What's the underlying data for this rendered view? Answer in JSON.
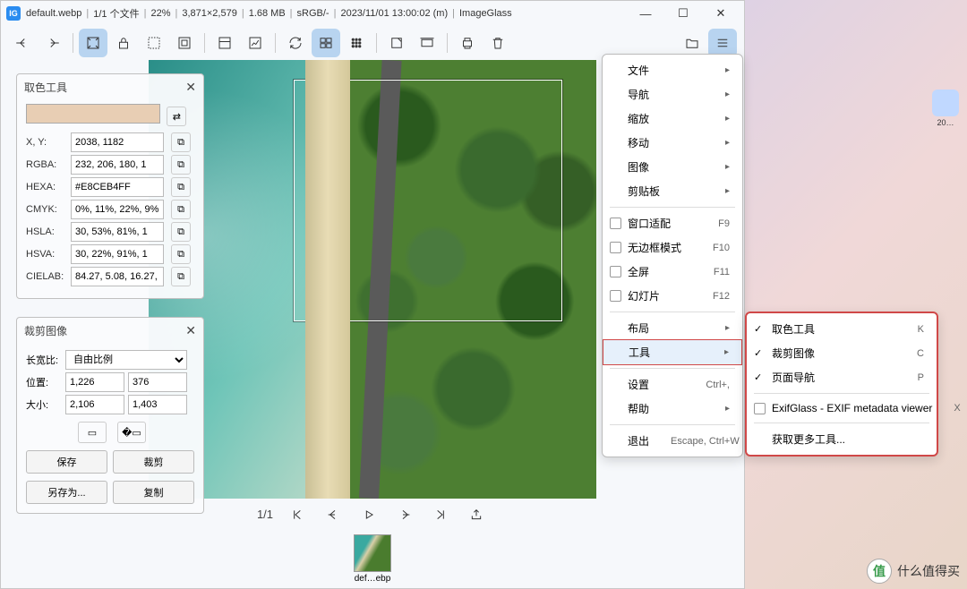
{
  "titlebar": {
    "app_icon": "IG",
    "filename": "default.webp",
    "file_count": "1/1 个文件",
    "zoom": "22%",
    "dimensions": "3,871×2,579",
    "filesize": "1.68 MB",
    "colorspace": "sRGB/-",
    "datetime": "2023/11/01 13:00:02 (m)",
    "app_name": "ImageGlass",
    "sep": "|"
  },
  "winbtns": {
    "min": "—",
    "max": "☐",
    "close": "✕"
  },
  "toolbar": {
    "names": [
      "back",
      "forward",
      "fit-window",
      "lock",
      "select",
      "crop",
      "color-picker",
      "chart",
      "refresh",
      "grid-small",
      "grid-large",
      "fullscreen",
      "slideshow",
      "print",
      "delete",
      "open",
      "menu"
    ]
  },
  "color_picker": {
    "title": "取色工具",
    "xy_label": "X, Y:",
    "xy_value": "2038, 1182",
    "rgba_label": "RGBA:",
    "rgba_value": "232, 206, 180, 1",
    "hexa_label": "HEXA:",
    "hexa_value": "#E8CEB4FF",
    "cmyk_label": "CMYK:",
    "cmyk_value": "0%, 11%, 22%, 9%",
    "hsla_label": "HSLA:",
    "hsla_value": "30, 53%, 81%, 1",
    "hsva_label": "HSVA:",
    "hsva_value": "30, 22%, 91%, 1",
    "cielab_label": "CIELAB:",
    "cielab_value": "84.27, 5.08, 16.27, 1",
    "swatch_color": "#e8ceb4"
  },
  "crop_panel": {
    "title": "裁剪图像",
    "ratio_label": "长宽比:",
    "ratio_value": "自由比例",
    "pos_label": "位置:",
    "pos_x": "1,226",
    "pos_y": "376",
    "size_label": "大小:",
    "size_w": "2,106",
    "size_h": "1,403",
    "save": "保存",
    "crop": "裁剪",
    "saveas": "另存为...",
    "copy": "复制"
  },
  "bottombar": {
    "page": "1/1"
  },
  "thumb": {
    "label": "def…ebp"
  },
  "menu": {
    "file": "文件",
    "nav": "导航",
    "zoom": "缩放",
    "move": "移动",
    "image": "图像",
    "clipboard": "剪贴板",
    "fit_window": "窗口适配",
    "fit_window_key": "F9",
    "borderless": "无边框模式",
    "borderless_key": "F10",
    "fullscreen": "全屏",
    "fullscreen_key": "F11",
    "slideshow": "幻灯片",
    "slideshow_key": "F12",
    "layout": "布局",
    "tools": "工具",
    "settings": "设置",
    "settings_key": "Ctrl+,",
    "help": "帮助",
    "exit": "退出",
    "exit_key": "Escape, Ctrl+W"
  },
  "submenu": {
    "color_picker": "取色工具",
    "color_picker_key": "K",
    "crop": "裁剪图像",
    "crop_key": "C",
    "page_nav": "页面导航",
    "page_nav_key": "P",
    "exifglass": "ExifGlass - EXIF metadata viewer",
    "exifglass_key": "X",
    "more": "获取更多工具..."
  },
  "watermark": {
    "text": "什么值得买",
    "badge": "值"
  },
  "desk_icon": {
    "label": "20…"
  }
}
